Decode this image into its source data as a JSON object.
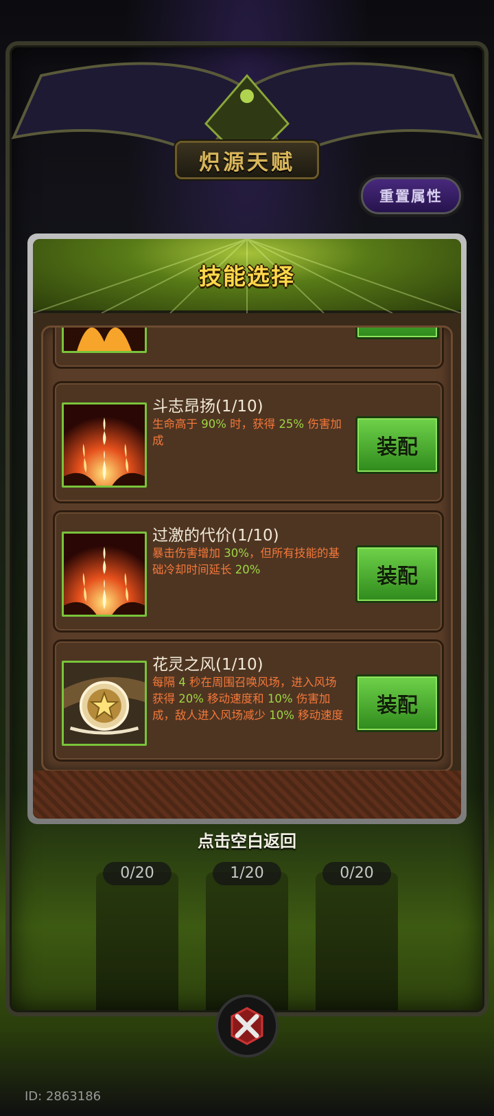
{
  "header": {
    "title": "炽源天赋",
    "reset_button": "重置属性"
  },
  "modal": {
    "title": "技能选择",
    "skills": [
      {
        "name": "斗志昂扬(1/10)",
        "desc_parts": [
          "生命高于 ",
          "90%",
          " 时，获得 ",
          "25%",
          " 伤害加成"
        ],
        "icon": "flame-burst-icon",
        "button": "装配"
      },
      {
        "name": "过激的代价(1/10)",
        "desc_parts": [
          "暴击伤害增加 ",
          "30%",
          "，但所有技能的基础冷却时间延长 ",
          "20%",
          ""
        ],
        "icon": "flame-burst-icon",
        "button": "装配"
      },
      {
        "name": "花灵之风(1/10)",
        "desc_parts": [
          "每隔 ",
          "4",
          " 秒在周围召唤风场，进入风场获得 ",
          "20%",
          " 移动速度和 ",
          "10%",
          " 伤害加成，敌人进入风场减少 ",
          "10%",
          " 移动速度"
        ],
        "icon": "star-orb-icon",
        "button": "装配"
      }
    ]
  },
  "tap_hint": "点击空白返回",
  "slots": [
    "0/20",
    "1/20",
    "0/20"
  ],
  "id_label": "ID: 2863186",
  "colors": {
    "accent_green": "#9fd644",
    "desc_orange": "#f4783a",
    "title_gold": "#ffd84a"
  }
}
